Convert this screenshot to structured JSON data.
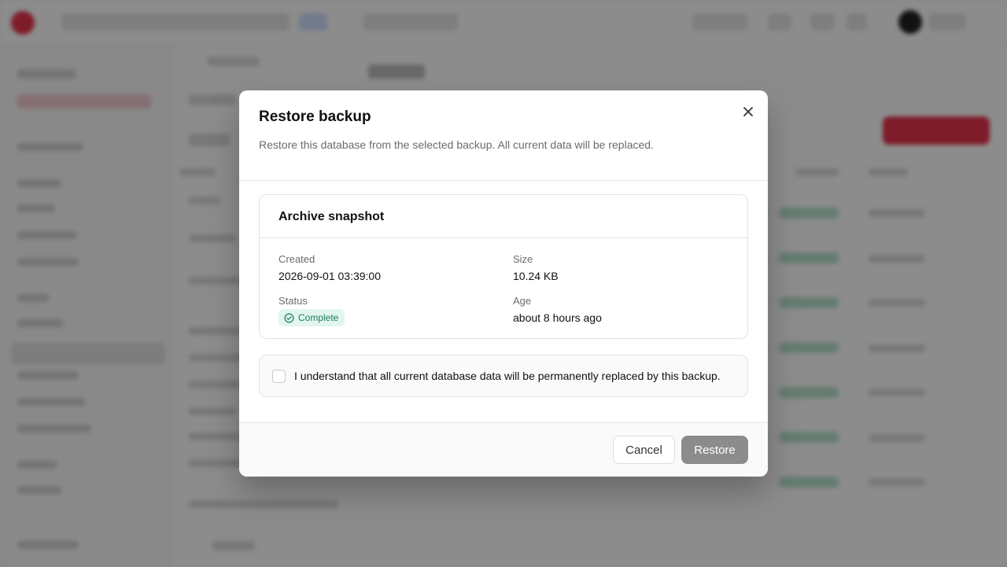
{
  "dialog": {
    "title": "Restore backup",
    "description": "Restore this database from the selected backup. All current data will be replaced."
  },
  "snapshot": {
    "title": "Archive snapshot",
    "created_label": "Created",
    "created_value": "2026-09-01 03:39:00",
    "size_label": "Size",
    "size_value": "10.24 KB",
    "status_label": "Status",
    "status_value": "Complete",
    "age_label": "Age",
    "age_value": "about 8 hours ago"
  },
  "confirm": {
    "text": "I understand that all current database data will be permanently replaced by this backup.",
    "checked": false
  },
  "footer": {
    "cancel_label": "Cancel",
    "restore_label": "Restore"
  },
  "colors": {
    "overlay": "#000000",
    "status_bg": "#e2f5ee",
    "status_text": "#1a7f5a",
    "restore_disabled": "#8c8c8c",
    "brand": "#e5334d"
  },
  "icons": {
    "close": "close-icon",
    "status": "check-circle-icon"
  }
}
